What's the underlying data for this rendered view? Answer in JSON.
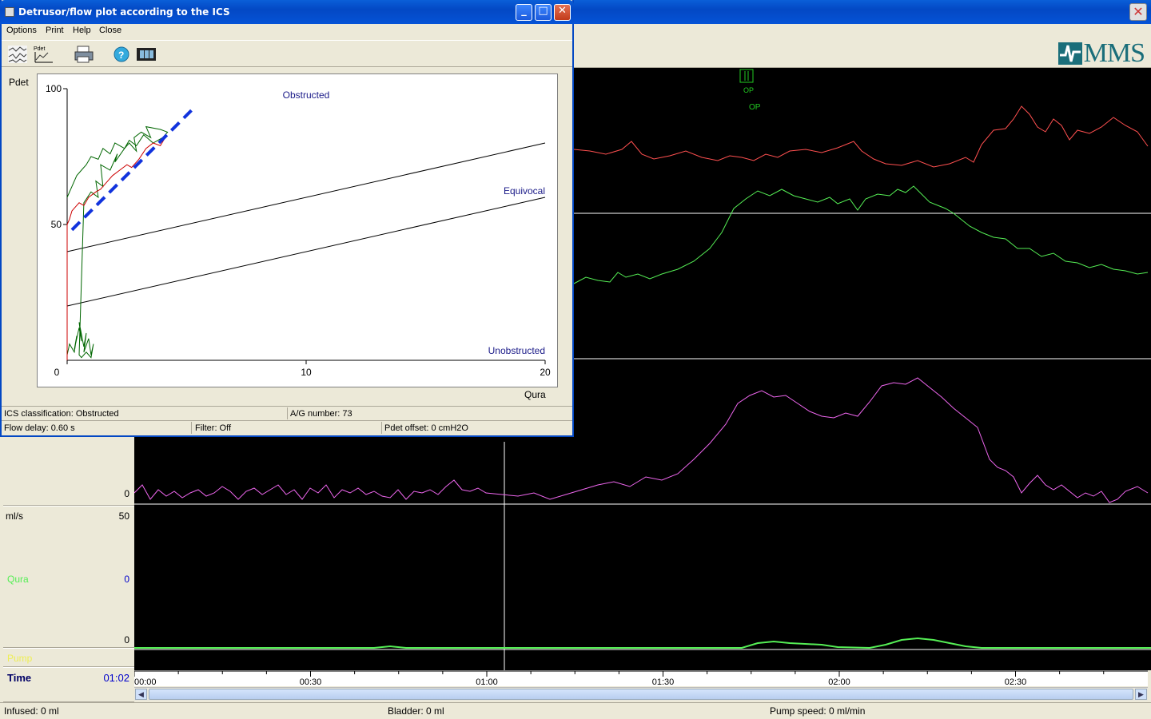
{
  "main_window": {
    "brand": "MMS",
    "channels": {
      "unit_ml_s": "ml/s",
      "unit_ml_s_max": "50",
      "channel_3_zero": "0",
      "qura_label": "Qura",
      "qura_value": "0",
      "qura_zero": "0",
      "pump_label": "Pump",
      "time_label": "Time",
      "time_value": "01:02"
    },
    "marker_label": "OP",
    "marker_label_2": "OP",
    "time_ticks": [
      "00:00",
      "00:30",
      "01:00",
      "01:30",
      "02:00",
      "02:30"
    ],
    "status": {
      "infused": "Infused: 0 ml",
      "bladder": "Bladder: 0 ml",
      "pump_speed": "Pump speed: 0 ml/min"
    },
    "colors": {
      "pves": "#ff5050",
      "pdet_trace": "#55ee55",
      "pabd": "#ee66ee",
      "qura": "#55ee55",
      "plot_bg": "#000000"
    }
  },
  "dialog": {
    "title": "Detrusor/flow plot according to the ICS",
    "menu": [
      "Options",
      "Print",
      "Help",
      "Close"
    ],
    "toolbar_icons": [
      "trace-view-icon",
      "pdet-view-icon",
      "print-icon",
      "help-icon",
      "film-icon"
    ],
    "y_axis_label": "Pdet",
    "x_axis_label": "Qura",
    "status": {
      "ics_classification": "ICS classification: Obstructed",
      "ag_number": "A/G number: 73",
      "flow_delay": "Flow delay: 0.60 s",
      "filter": "Filter: Off",
      "pdet_offset": "Pdet offset: 0 cmH2O"
    }
  },
  "chart_data": {
    "type": "line",
    "xlabel": "Qura",
    "ylabel": "Pdet",
    "xlim": [
      0,
      20
    ],
    "ylim": [
      0,
      100
    ],
    "x_ticks": [
      "0",
      "10",
      "20"
    ],
    "y_ticks": [
      "50",
      "100"
    ],
    "grid": false,
    "region_labels": [
      "Obstructed",
      "Equivocal",
      "Unobstructed"
    ],
    "boundary_lines": [
      {
        "name": "obstructed-equivocal",
        "x": [
          0,
          20
        ],
        "y": [
          40,
          80
        ]
      },
      {
        "name": "equivocal-unobstructed",
        "x": [
          0,
          20
        ],
        "y": [
          20,
          60
        ]
      }
    ],
    "ag_line": {
      "x": [
        0.2,
        5.2
      ],
      "y": [
        48,
        92
      ],
      "color": "#1133dd"
    },
    "series": [
      {
        "color": "#006600",
        "x": [
          0.0,
          0.1,
          0.3,
          0.4,
          0.3,
          0.5,
          0.6,
          0.5,
          0.7,
          0.8,
          0.7,
          0.9,
          1.0,
          1.1,
          1.0,
          0.8,
          0.6,
          0.5,
          0.7,
          1.0,
          1.3,
          1.2,
          1.5,
          1.4,
          1.8,
          2.1,
          2.0,
          2.4,
          2.6,
          2.9,
          2.8,
          3.1,
          3.5,
          3.3,
          3.9,
          4.2,
          4.0,
          3.6,
          3.2,
          2.9,
          2.6,
          2.4,
          2.0,
          1.8,
          1.5,
          1.3,
          1.0,
          0.8,
          0.6,
          0.4,
          0.2,
          0.0
        ],
        "y": [
          2,
          6,
          3,
          9,
          4,
          12,
          7,
          14,
          5,
          10,
          3,
          8,
          2,
          6,
          1,
          3,
          1,
          2,
          58,
          62,
          60,
          66,
          64,
          72,
          70,
          76,
          73,
          78,
          80,
          77,
          82,
          84,
          82,
          86,
          85,
          84,
          82,
          80,
          83,
          79,
          81,
          78,
          80,
          76,
          78,
          74,
          75,
          72,
          70,
          68,
          64,
          60
        ]
      },
      {
        "color": "#cc0000",
        "x": [
          0.0,
          0.0,
          0.1,
          0.2,
          0.3,
          0.5,
          0.7,
          0.9,
          1.2,
          1.4,
          1.7,
          1.9,
          2.2,
          2.5,
          2.7,
          3.0,
          3.3,
          3.6,
          3.9,
          4.1
        ],
        "y": [
          0,
          50,
          52,
          55,
          56,
          58,
          57,
          60,
          62,
          63,
          66,
          68,
          70,
          72,
          71,
          74,
          78,
          80,
          79,
          82
        ]
      }
    ]
  }
}
